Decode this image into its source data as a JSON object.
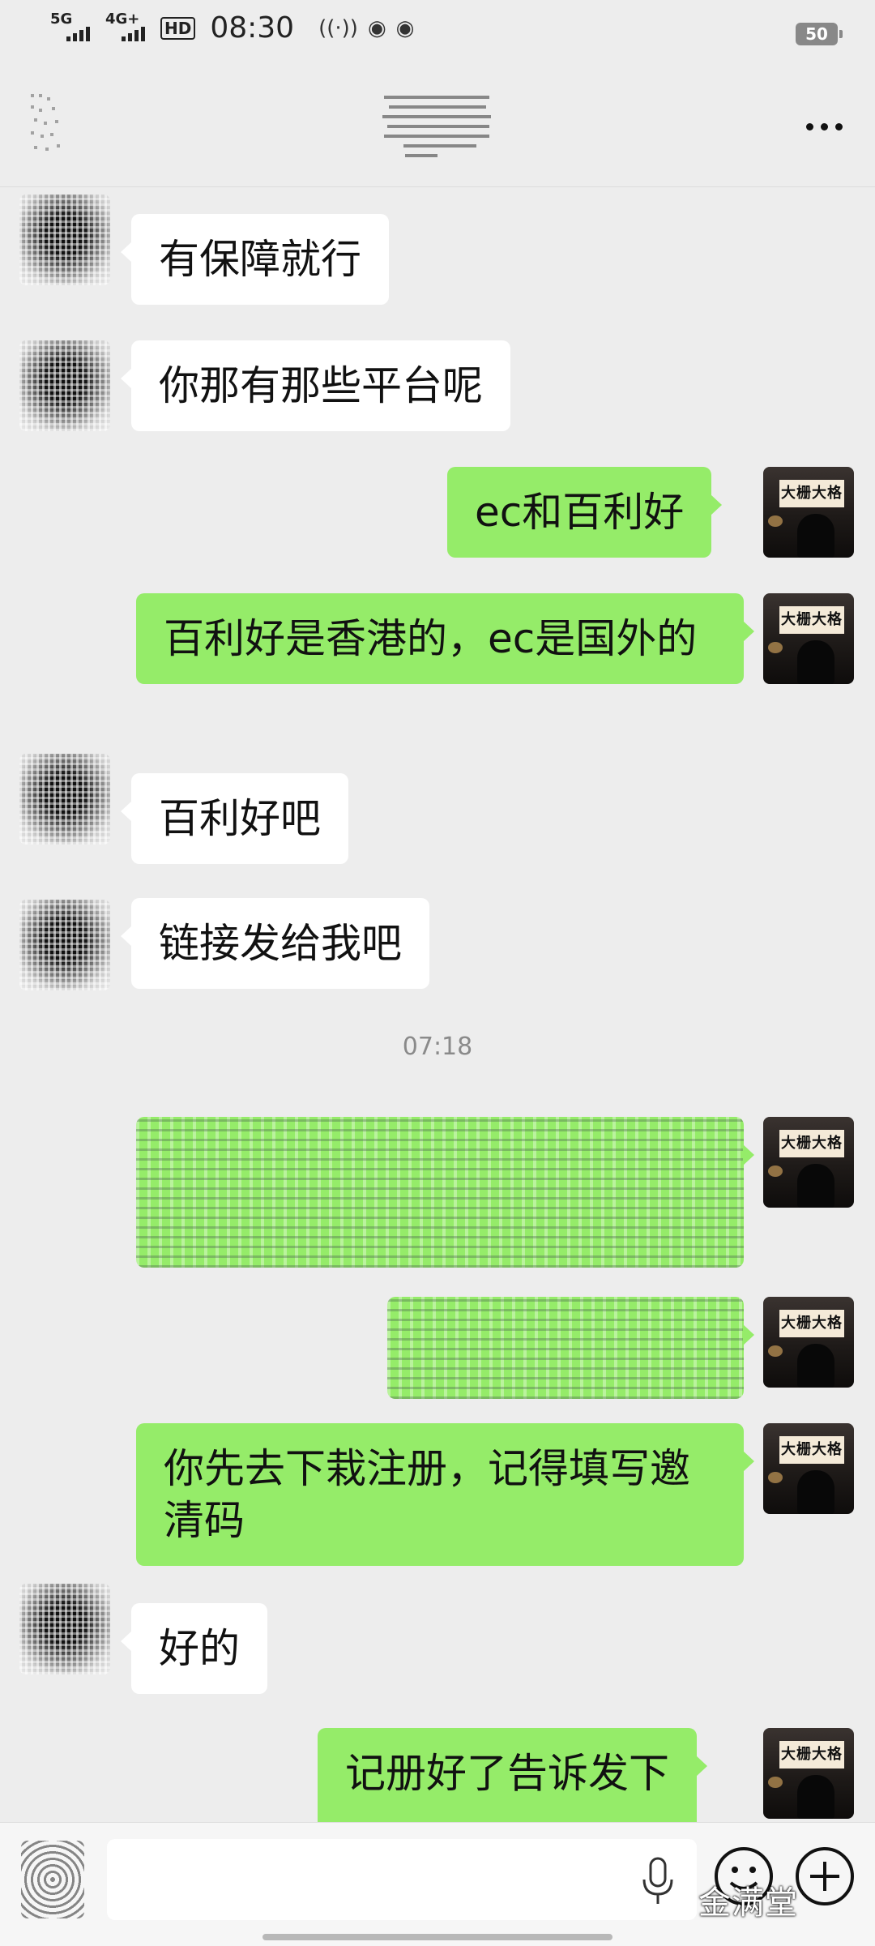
{
  "status_bar": {
    "network1": "5G",
    "network2": "4G+",
    "hd_label": "HD",
    "time": "08:30",
    "battery": "50"
  },
  "messages": [
    {
      "sender": "other",
      "text": "有保障就行"
    },
    {
      "sender": "other",
      "text": "你那有那些平台呢"
    },
    {
      "sender": "me",
      "text": "ec和百利好"
    },
    {
      "sender": "me",
      "text": "百利好是香港的，ec是国外的"
    },
    {
      "sender": "other",
      "text": "百利好吧"
    },
    {
      "sender": "other",
      "text": "链接发给我吧"
    },
    {
      "sender": "me",
      "text": "你先去下栽注册，记得填写邀清码"
    },
    {
      "sender": "other",
      "text": "好的"
    },
    {
      "sender": "me",
      "text": "记册好了告诉发下"
    }
  ],
  "timestamp": "07:18",
  "avatar_sign": "大栅大格",
  "input_bar": {
    "watermark": "金满堂"
  },
  "icons": {
    "back": "back-icon",
    "more": "more-icon",
    "voice": "voice-toggle-icon",
    "mic": "mic-icon",
    "emoji": "emoji-icon",
    "plus": "plus-icon"
  },
  "colors": {
    "background": "#ededed",
    "my_bubble": "#95ec69",
    "other_bubble": "#ffffff",
    "timestamp": "#8a8a8a"
  }
}
